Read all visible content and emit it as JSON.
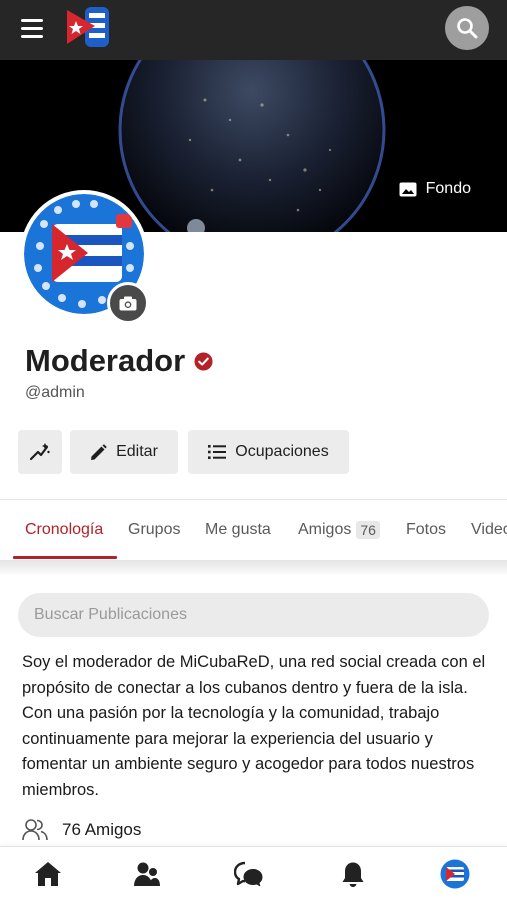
{
  "colors": {
    "accent": "#b22228",
    "topbar": "#262626",
    "button_bg": "#ececec"
  },
  "header": {
    "menu_icon": "hamburger-icon",
    "logo": "micubared-logo",
    "search_icon": "search-icon"
  },
  "cover": {
    "background_button_label": "Fondo",
    "background_icon": "image-icon"
  },
  "profile": {
    "name": "Moderador",
    "handle": "@admin",
    "verified": true
  },
  "actions": {
    "magic_icon": "magic-wand-icon",
    "edit_label": "Editar",
    "occupations_label": "Ocupaciones"
  },
  "tabs": [
    {
      "label": "Cronología",
      "active": true
    },
    {
      "label": "Grupos"
    },
    {
      "label": "Me gusta"
    },
    {
      "label": "Amigos",
      "badge": "76"
    },
    {
      "label": "Fotos"
    },
    {
      "label": "Videos"
    }
  ],
  "post_search": {
    "placeholder": "Buscar Publicaciones"
  },
  "bio": "Soy el moderador de MiCubaReD, una red social creada con el propósito de conectar a los cubanos dentro y fuera de la isla. Con una pasión por la tecnología y la comunidad, trabajo continuamente para mejorar la experiencia del usuario y fomentar un ambiente seguro y acogedor para todos nuestros miembros.",
  "friends": {
    "label": "76 Amigos"
  },
  "bottom_nav": [
    {
      "icon": "home-icon"
    },
    {
      "icon": "users-icon"
    },
    {
      "icon": "chat-icon"
    },
    {
      "icon": "bell-icon"
    },
    {
      "icon": "profile-avatar"
    }
  ]
}
